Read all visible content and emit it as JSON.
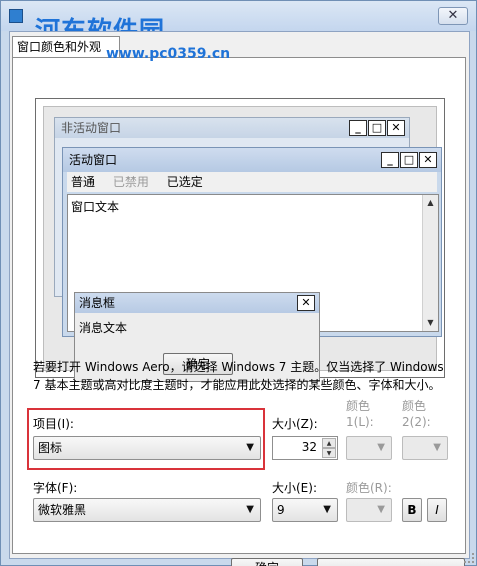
{
  "window": {
    "watermark": "河东软件园",
    "watermark_url": "www.pc0359.cn",
    "close_symbol": "✕"
  },
  "tab": {
    "label": "窗口颜色和外观"
  },
  "preview": {
    "inactive_title": "非活动窗口",
    "active_title": "活动窗口",
    "menu": {
      "normal": "普通",
      "disabled": "已禁用",
      "selected": "已选定"
    },
    "window_text": "窗口文本",
    "msgbox_title": "消息框",
    "msgbox_text": "消息文本",
    "msgbox_ok": "确定",
    "caption_buttons": {
      "min": "_",
      "max": "□",
      "close": "✕"
    }
  },
  "description": "若要打开 Windows Aero，请选择 Windows 7 主题。仅当选择了 Windows 7 基本主题或高对比度主题时，才能应用此处选择的某些颜色、字体和大小。",
  "item": {
    "label": "项目(I):",
    "value": "图标",
    "size_label": "大小(Z):",
    "size_value": "32",
    "color1_label": "颜色 1(L):",
    "color2_label": "颜色 2(2):"
  },
  "font": {
    "label": "字体(F):",
    "value": "微软雅黑",
    "size_label": "大小(E):",
    "size_value": "9",
    "color_label": "颜色(R):",
    "bold": "B",
    "italic": "I"
  },
  "footer": {
    "ok": "确定"
  },
  "colors": {
    "highlight": "#d9333a",
    "title_active": "#b5c9e3",
    "watermark": "#1f73d8"
  }
}
